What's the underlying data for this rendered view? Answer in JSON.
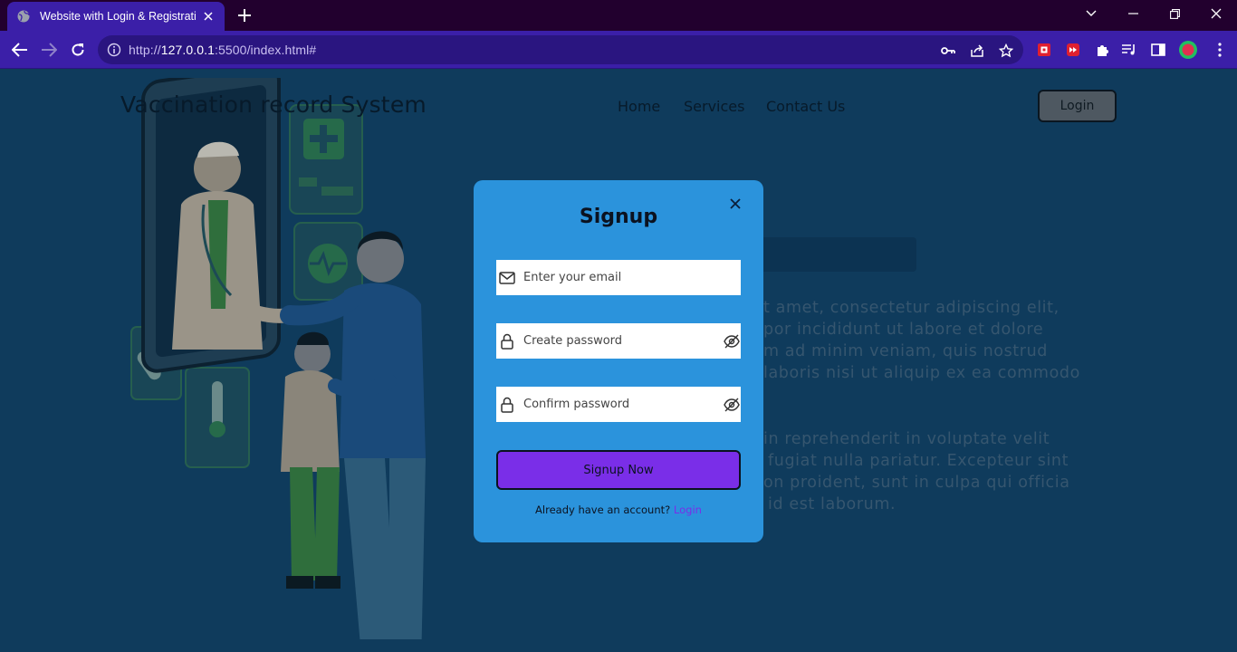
{
  "browser": {
    "tab_title": "Website with Login & Registratio",
    "url_prefix": "http://",
    "url_host": "127.0.0.1",
    "url_rest": ":5500/index.html#"
  },
  "page": {
    "brand": "Vaccination record System",
    "nav": {
      "home": "Home",
      "services": "Services",
      "contact": "Contact Us"
    },
    "login_button": "Login",
    "lorem": [
      "t amet, consectetur adipiscing elit,",
      "por incididunt ut labore et dolore",
      "m ad minim veniam, quis nostrud",
      "laboris nisi ut aliquip ex ea commodo",
      "in reprehenderit in voluptate velit",
      "fugiat nulla pariatur. Excepteur sint",
      "on proident, sunt in culpa qui officia",
      "id est laborum."
    ]
  },
  "modal": {
    "title": "Signup",
    "email_placeholder": "Enter your email",
    "password_placeholder": "Create password",
    "confirm_placeholder": "Confirm password",
    "submit_label": "Signup Now",
    "footer_text": "Already have an account?",
    "footer_link": "Login"
  },
  "colors": {
    "tab_bar": "#22002e",
    "toolbar": "#3b1fa8",
    "page_bg": "#0f3b5c",
    "modal_bg": "#2b93dc",
    "accent": "#7a2ee8"
  }
}
